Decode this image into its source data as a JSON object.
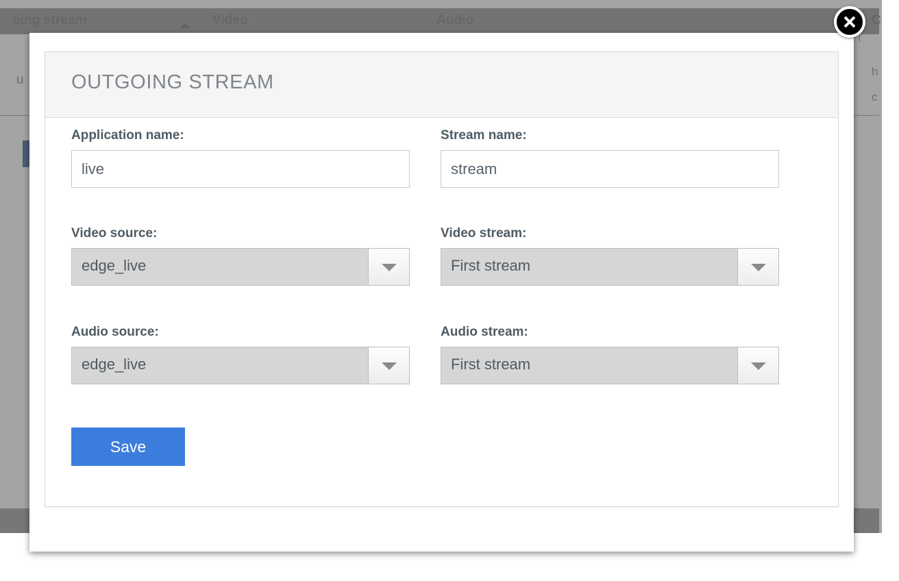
{
  "background": {
    "table_headers": [
      {
        "label": "oing stream",
        "sort": "ascending"
      },
      {
        "label": "Video"
      },
      {
        "label": "Audio"
      },
      {
        "label": "C"
      }
    ],
    "body_text": "u",
    "right_text_1": "h",
    "right_text_2": "c"
  },
  "modal": {
    "close_label": "close-icon",
    "panel": {
      "title": "OUTGOING STREAM",
      "fields": {
        "application_name": {
          "label": "Application name:",
          "value": "live",
          "placeholder": ""
        },
        "stream_name": {
          "label": "Stream name:",
          "value": "stream",
          "placeholder": ""
        },
        "video_source": {
          "label": "Video source:",
          "value": "edge_live"
        },
        "video_stream": {
          "label": "Video stream:",
          "value": "First stream"
        },
        "audio_source": {
          "label": "Audio source:",
          "value": "edge_live"
        },
        "audio_stream": {
          "label": "Audio stream:",
          "value": "First stream"
        }
      },
      "save_label": "Save"
    }
  },
  "colors": {
    "accent_blue": "#3b7ddd",
    "panel_header_bg": "#f5f5f5",
    "select_bg": "#d6d6d6",
    "title_text": "#80868c",
    "label_text": "#4f5b63"
  }
}
